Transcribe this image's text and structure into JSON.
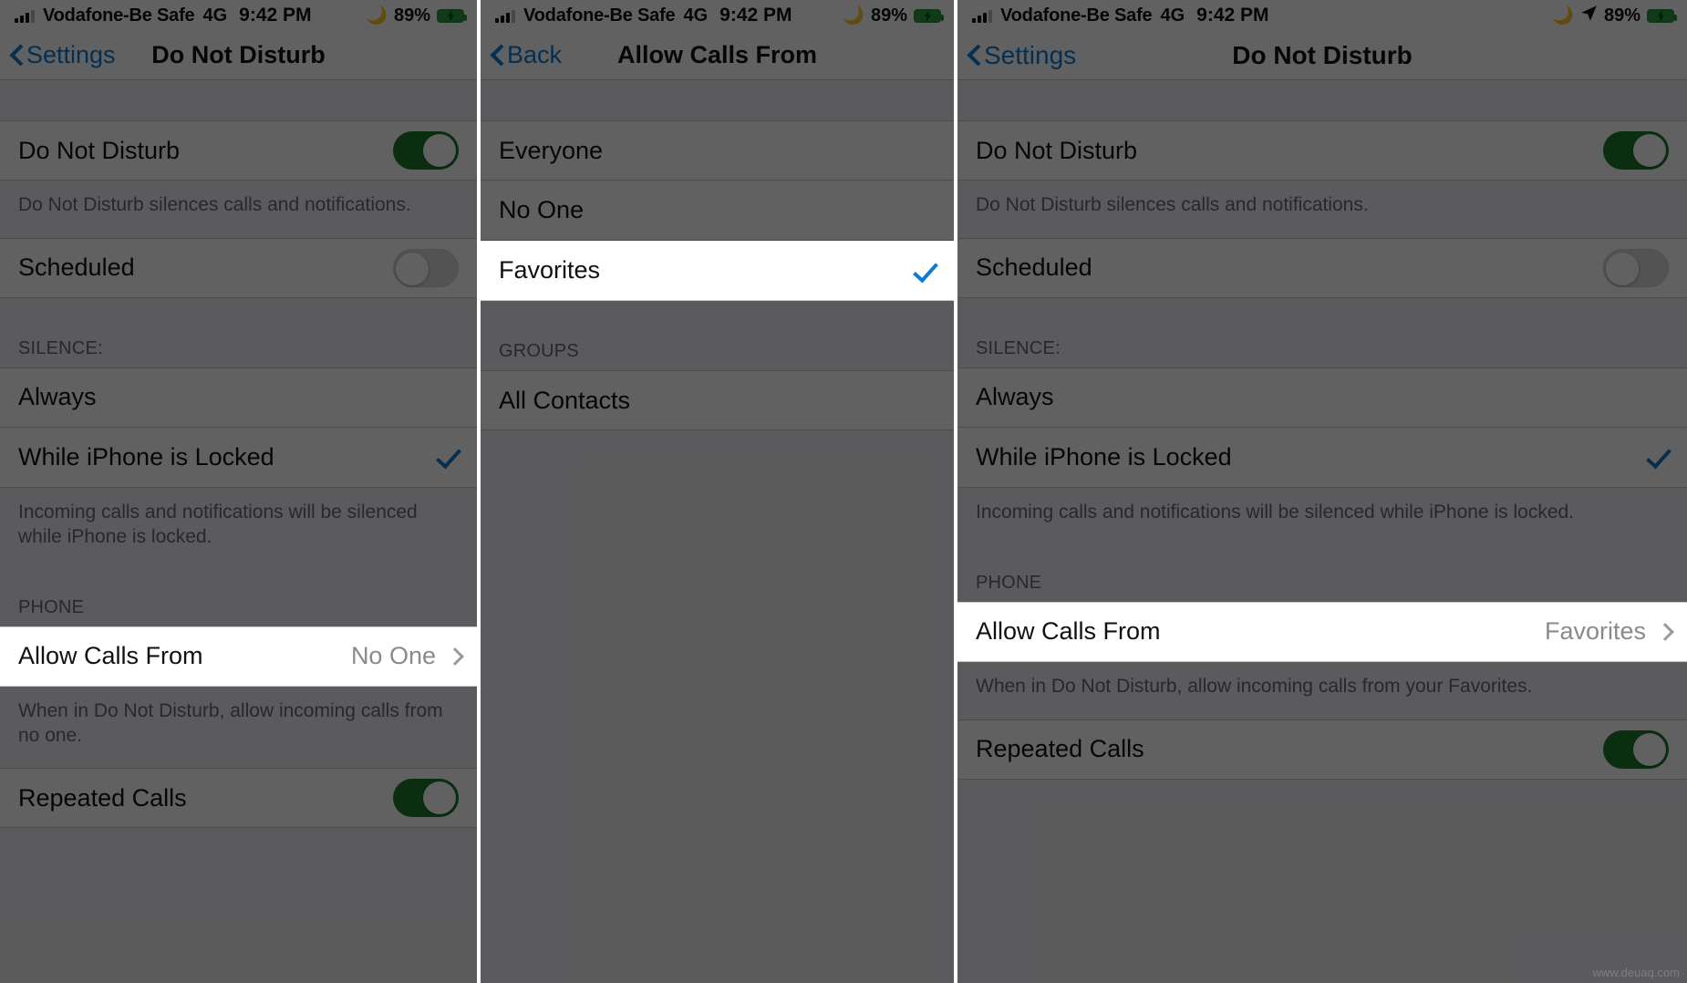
{
  "colors": {
    "accent_blue": "#0b7bd4",
    "toggle_on_green": "#1d7a2d",
    "battery_green": "#2f9c40",
    "group_bg": "#eeeef3",
    "row_bg": "#ffffff",
    "separator": "#c8c7cc",
    "dim_overlay": "rgba(0,0,0,0.62)"
  },
  "status_bar": {
    "carrier": "Vodafone-Be Safe",
    "network": "4G",
    "time": "9:42 PM",
    "battery_percent": "89%",
    "moon_icon": "moon-icon",
    "location_icon": "location-arrow-icon",
    "battery_icon": "battery-charging-icon",
    "signal_icon": "signal-bars-icon"
  },
  "panel1": {
    "nav": {
      "back_label": "Settings",
      "title": "Do Not Disturb"
    },
    "rows": {
      "do_not_disturb": {
        "label": "Do Not Disturb",
        "toggle": "on"
      },
      "do_not_disturb_footnote": "Do Not Disturb silences calls and notifications.",
      "scheduled": {
        "label": "Scheduled",
        "toggle": "off"
      },
      "silence_header": "SILENCE:",
      "always": {
        "label": "Always",
        "checked": false
      },
      "while_locked": {
        "label": "While iPhone is Locked",
        "checked": true
      },
      "silence_footnote": "Incoming calls and notifications will be silenced while iPhone is locked.",
      "phone_header": "PHONE",
      "allow_calls_from": {
        "label": "Allow Calls From",
        "value": "No One"
      },
      "allow_calls_footnote": "When in Do Not Disturb, allow incoming calls from no one.",
      "repeated_calls": {
        "label": "Repeated Calls",
        "toggle": "on"
      }
    }
  },
  "panel2": {
    "nav": {
      "back_label": "Back",
      "title": "Allow Calls From"
    },
    "options": [
      {
        "label": "Everyone",
        "checked": false
      },
      {
        "label": "No One",
        "checked": false
      },
      {
        "label": "Favorites",
        "checked": true
      }
    ],
    "groups_header": "GROUPS",
    "groups": [
      {
        "label": "All Contacts",
        "checked": false
      }
    ]
  },
  "panel3": {
    "nav": {
      "back_label": "Settings",
      "title": "Do Not Disturb"
    },
    "rows": {
      "do_not_disturb": {
        "label": "Do Not Disturb",
        "toggle": "on"
      },
      "do_not_disturb_footnote": "Do Not Disturb silences calls and notifications.",
      "scheduled": {
        "label": "Scheduled",
        "toggle": "off"
      },
      "silence_header": "SILENCE:",
      "always": {
        "label": "Always",
        "checked": false
      },
      "while_locked": {
        "label": "While iPhone is Locked",
        "checked": true
      },
      "silence_footnote": "Incoming calls and notifications will be silenced while iPhone is locked.",
      "phone_header": "PHONE",
      "allow_calls_from": {
        "label": "Allow Calls From",
        "value": "Favorites"
      },
      "allow_calls_footnote": "When in Do Not Disturb, allow incoming calls from your Favorites.",
      "repeated_calls": {
        "label": "Repeated Calls",
        "toggle": "on"
      }
    },
    "watermark": "www.deuaq.com"
  }
}
